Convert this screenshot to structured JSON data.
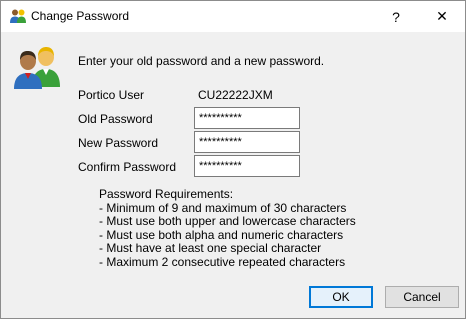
{
  "window": {
    "title": "Change Password",
    "help_glyph": "?",
    "close_glyph": "✕",
    "title_icon": "users-icon",
    "dialog_icon": "users-icon"
  },
  "form": {
    "instruction": "Enter your old password and a new password.",
    "user_label": "Portico User",
    "user_value": "CU22222JXM",
    "old_password_label": "Old Password",
    "old_password_value": "**********",
    "new_password_label": "New Password",
    "new_password_value": "**********",
    "confirm_password_label": "Confirm Password",
    "confirm_password_value": "**********"
  },
  "requirements": {
    "title": "Password Requirements:",
    "items": [
      " - Minimum of 9 and maximum of 30 characters",
      " - Must use both upper and lowercase characters",
      " - Must use both alpha and numeric characters",
      " - Must have at least one special character",
      " - Maximum 2 consecutive repeated characters"
    ]
  },
  "buttons": {
    "ok_label": "OK",
    "cancel_label": "Cancel"
  },
  "colors": {
    "accent": "#0078d7",
    "dialog_bg": "#f0f0f0"
  }
}
